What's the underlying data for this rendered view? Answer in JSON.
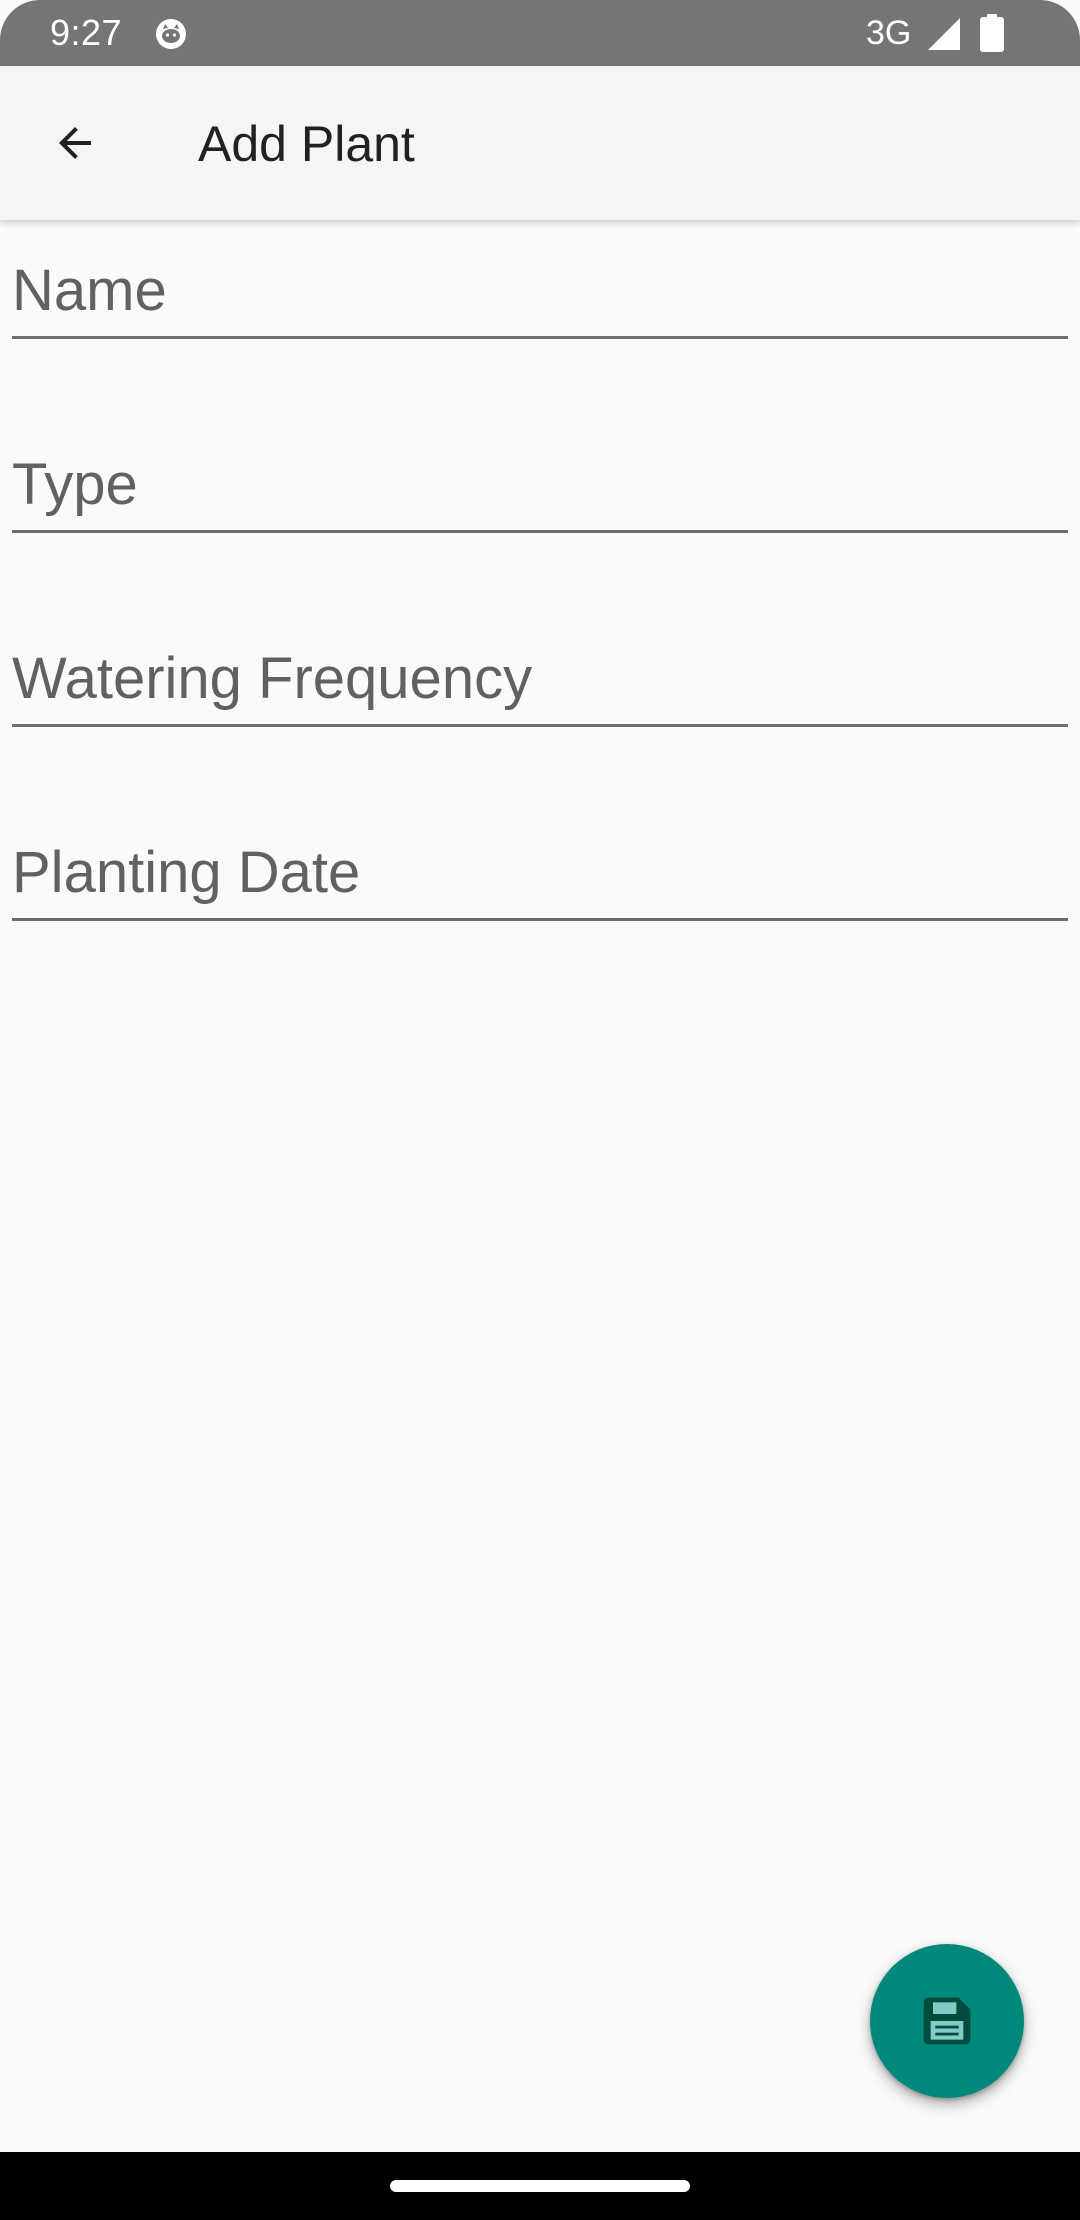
{
  "status_bar": {
    "time": "9:27",
    "network": "3G",
    "icons": [
      "cat-notification-icon",
      "signal-icon",
      "battery-icon"
    ]
  },
  "app_bar": {
    "title": "Add Plant",
    "back_icon": "arrow-back-icon"
  },
  "form": {
    "name": {
      "placeholder": "Name",
      "value": ""
    },
    "type": {
      "placeholder": "Type",
      "value": ""
    },
    "watering_frequency": {
      "placeholder": "Watering Frequency",
      "value": ""
    },
    "planting_date": {
      "placeholder": "Planting Date",
      "value": ""
    }
  },
  "fab": {
    "icon": "save-icon",
    "color": "#00897b"
  },
  "colors": {
    "status_bar": "#757575",
    "app_bar": "#f5f5f5",
    "background": "#fafafa",
    "accent": "#00897b"
  }
}
